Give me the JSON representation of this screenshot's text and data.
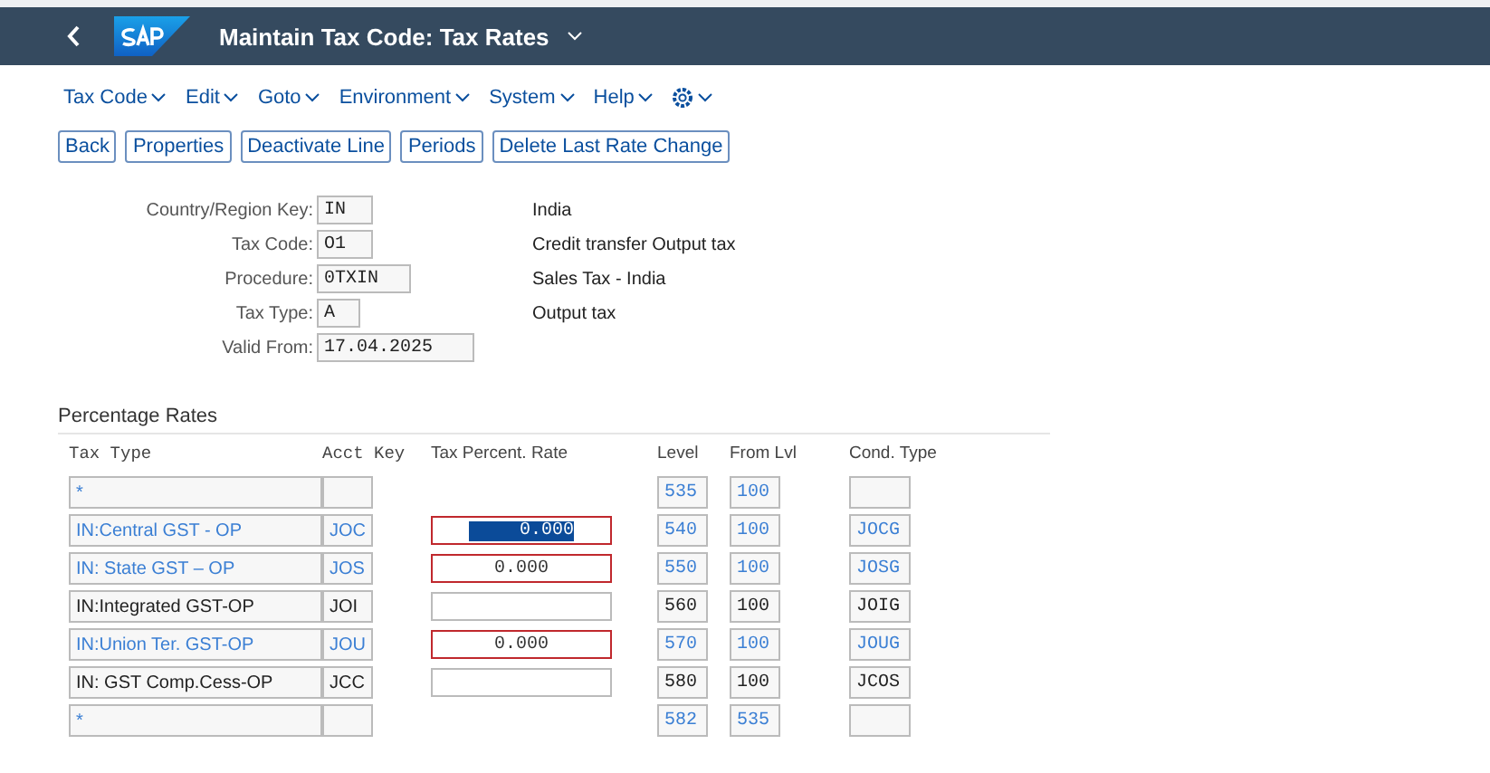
{
  "header": {
    "title": "Maintain Tax Code: Tax Rates"
  },
  "menu": [
    {
      "label": "Tax Code",
      "kind": "text"
    },
    {
      "label": "Edit",
      "kind": "text"
    },
    {
      "label": "Goto",
      "kind": "text"
    },
    {
      "label": "Environment",
      "kind": "text"
    },
    {
      "label": "System",
      "kind": "text"
    },
    {
      "label": "Help",
      "kind": "text"
    },
    {
      "kind": "settings"
    }
  ],
  "toolbar": [
    "Back",
    "Properties",
    "Deactivate Line",
    "Periods",
    "Delete Last Rate Change"
  ],
  "form": [
    {
      "label": "Country/Region Key:",
      "value": "IN",
      "description": "India"
    },
    {
      "label": "Tax Code:",
      "value": "O1",
      "description": "Credit transfer Output tax"
    },
    {
      "label": "Procedure:",
      "value": "0TXIN",
      "description": "Sales Tax - India"
    },
    {
      "label": "Tax Type:",
      "value": "A",
      "description": "Output tax"
    },
    {
      "label": "Valid From:",
      "value": "17.04.2025"
    }
  ],
  "rates": {
    "title": "Percentage Rates",
    "columns": [
      "Tax Type",
      "Acct Key",
      "Tax Percent. Rate",
      "Level",
      "From Lvl",
      "Cond. Type"
    ],
    "rows": [
      {
        "kind": "blank",
        "tax_type": "*",
        "acct_key": "",
        "linked": true,
        "level": "535",
        "from_lvl": "100",
        "cond_type": ""
      },
      {
        "kind": "rate",
        "tax_type": "IN:Central GST - OP",
        "acct_key": "JOC",
        "rate": "0.000",
        "error": true,
        "selected": true,
        "linked": true,
        "level": "540",
        "from_lvl": "100",
        "cond_type": "JOCG"
      },
      {
        "kind": "rate",
        "tax_type": "IN: State GST – OP",
        "acct_key": "JOS",
        "rate": "0.000",
        "error": true,
        "selected": false,
        "linked": true,
        "level": "550",
        "from_lvl": "100",
        "cond_type": "JOSG"
      },
      {
        "kind": "rate",
        "tax_type": "IN:Integrated GST-OP",
        "acct_key": "JOI",
        "error": false,
        "selected": false,
        "linked": false,
        "level": "560",
        "from_lvl": "100",
        "cond_type": "JOIG"
      },
      {
        "kind": "rate",
        "tax_type": "IN:Union Ter. GST-OP",
        "acct_key": "JOU",
        "rate": "0.000",
        "error": true,
        "selected": false,
        "linked": true,
        "level": "570",
        "from_lvl": "100",
        "cond_type": "JOUG"
      },
      {
        "kind": "rate",
        "tax_type": "IN: GST Comp.Cess-OP",
        "acct_key": "JCC",
        "error": false,
        "selected": false,
        "linked": false,
        "level": "580",
        "from_lvl": "100",
        "cond_type": "JCOS"
      },
      {
        "kind": "blank",
        "tax_type": "*",
        "acct_key": "",
        "linked": true,
        "level": "582",
        "from_lvl": "535",
        "cond_type": ""
      }
    ]
  }
}
